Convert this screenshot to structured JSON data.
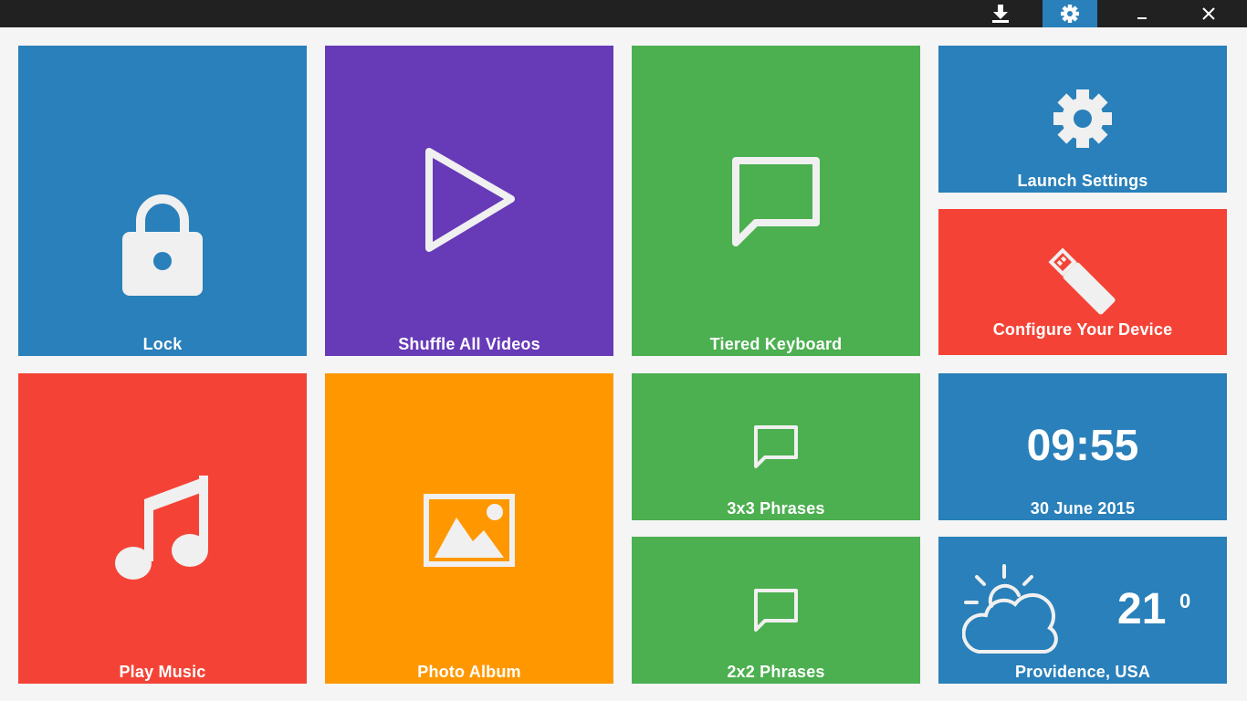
{
  "titlebar": {
    "buttons": [
      {
        "name": "download",
        "icon": "download-icon"
      },
      {
        "name": "settings",
        "icon": "gear-icon",
        "active": true
      },
      {
        "name": "minimize",
        "icon": "minimize-icon"
      },
      {
        "name": "close",
        "icon": "close-icon"
      }
    ]
  },
  "colors": {
    "blue": "#2980ba",
    "purple": "#673ab7",
    "green": "#4caf50",
    "red": "#f44336",
    "orange": "#ff9800",
    "background": "#f5f5f5",
    "titlebar": "#212121"
  },
  "tiles": {
    "lock": {
      "label": "Lock",
      "icon": "lock-icon"
    },
    "shuffle_videos": {
      "label": "Shuffle All Videos",
      "icon": "play-icon"
    },
    "tiered_keyboard": {
      "label": "Tiered Keyboard",
      "icon": "speech-bubble-icon"
    },
    "launch_settings": {
      "label": "Launch Settings",
      "icon": "gear-icon"
    },
    "configure_device": {
      "label": "Configure Your Device",
      "icon": "usb-drive-icon"
    },
    "play_music": {
      "label": "Play Music",
      "icon": "music-note-icon"
    },
    "photo_album": {
      "label": "Photo Album",
      "icon": "image-icon"
    },
    "phrases_3x3": {
      "label": "3x3 Phrases",
      "icon": "speech-bubble-icon"
    },
    "phrases_2x2": {
      "label": "2x2 Phrases",
      "icon": "speech-bubble-icon"
    },
    "clock": {
      "time": "09:55",
      "date": "30 June 2015"
    },
    "weather": {
      "temperature": "21",
      "unit": "0",
      "location": "Providence, USA",
      "icon": "partly-cloudy-icon"
    }
  }
}
